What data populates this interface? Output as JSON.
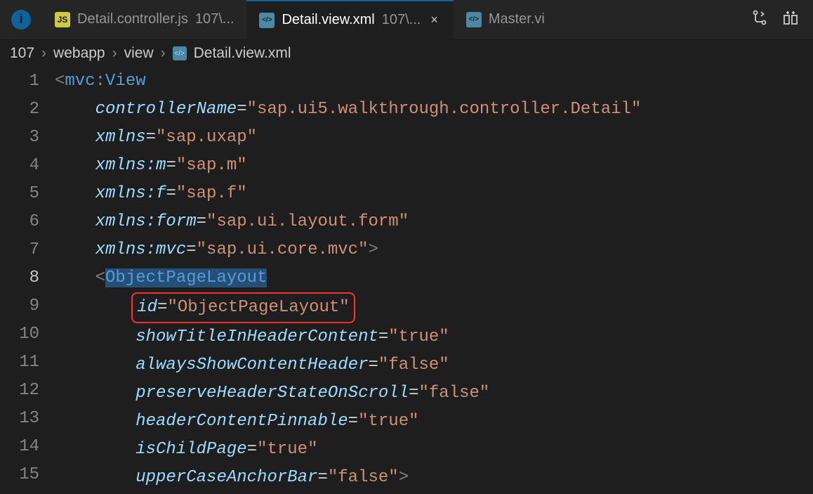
{
  "tabs": [
    {
      "icon_type": "js",
      "icon_text": "JS",
      "label": "Detail.controller.js",
      "suffix": "107\\...",
      "active": false,
      "closable": false
    },
    {
      "icon_type": "xml",
      "icon_text": "",
      "label": "Detail.view.xml",
      "suffix": "107\\...",
      "active": true,
      "closable": true
    },
    {
      "icon_type": "xml",
      "icon_text": "",
      "label": "Master.vi",
      "suffix": "",
      "active": false,
      "closable": false
    }
  ],
  "breadcrumb": {
    "parts": [
      "107",
      "webapp",
      "view"
    ],
    "file": "Detail.view.xml"
  },
  "code": {
    "lines": [
      {
        "n": 1,
        "indent": 0,
        "tokens": [
          [
            "punct",
            "<"
          ],
          [
            "tag-name",
            "mvc:View"
          ]
        ]
      },
      {
        "n": 2,
        "indent": 1,
        "tokens": [
          [
            "attr-name",
            "controllerName"
          ],
          [
            "op",
            "="
          ],
          [
            "attr-val",
            "\"sap.ui5.walkthrough.controller.Detail\""
          ]
        ]
      },
      {
        "n": 3,
        "indent": 1,
        "tokens": [
          [
            "attr-name",
            "xmlns"
          ],
          [
            "op",
            "="
          ],
          [
            "attr-val",
            "\"sap.uxap\""
          ]
        ]
      },
      {
        "n": 4,
        "indent": 1,
        "tokens": [
          [
            "attr-name",
            "xmlns:m"
          ],
          [
            "op",
            "="
          ],
          [
            "attr-val",
            "\"sap.m\""
          ]
        ]
      },
      {
        "n": 5,
        "indent": 1,
        "tokens": [
          [
            "attr-name",
            "xmlns:f"
          ],
          [
            "op",
            "="
          ],
          [
            "attr-val",
            "\"sap.f\""
          ]
        ]
      },
      {
        "n": 6,
        "indent": 1,
        "tokens": [
          [
            "attr-name",
            "xmlns:form"
          ],
          [
            "op",
            "="
          ],
          [
            "attr-val",
            "\"sap.ui.layout.form\""
          ]
        ]
      },
      {
        "n": 7,
        "indent": 1,
        "tokens": [
          [
            "attr-name",
            "xmlns:mvc"
          ],
          [
            "op",
            "="
          ],
          [
            "attr-val",
            "\"sap.ui.core.mvc\""
          ],
          [
            "punct",
            ">"
          ]
        ]
      },
      {
        "n": 8,
        "indent": 1,
        "current": true,
        "tokens": [
          [
            "punct",
            "<"
          ],
          [
            "tag-name selection",
            "ObjectPageLayout"
          ]
        ]
      },
      {
        "n": 9,
        "indent": 2,
        "highlight": true,
        "tokens": [
          [
            "attr-name",
            "id"
          ],
          [
            "op",
            "="
          ],
          [
            "attr-val",
            "\"ObjectPageLayout\""
          ]
        ]
      },
      {
        "n": 10,
        "indent": 2,
        "tokens": [
          [
            "attr-name",
            "showTitleInHeaderContent"
          ],
          [
            "op",
            "="
          ],
          [
            "attr-val",
            "\"true\""
          ]
        ]
      },
      {
        "n": 11,
        "indent": 2,
        "tokens": [
          [
            "attr-name",
            "alwaysShowContentHeader"
          ],
          [
            "op",
            "="
          ],
          [
            "attr-val",
            "\"false\""
          ]
        ]
      },
      {
        "n": 12,
        "indent": 2,
        "tokens": [
          [
            "attr-name",
            "preserveHeaderStateOnScroll"
          ],
          [
            "op",
            "="
          ],
          [
            "attr-val",
            "\"false\""
          ]
        ]
      },
      {
        "n": 13,
        "indent": 2,
        "tokens": [
          [
            "attr-name",
            "headerContentPinnable"
          ],
          [
            "op",
            "="
          ],
          [
            "attr-val",
            "\"true\""
          ]
        ]
      },
      {
        "n": 14,
        "indent": 2,
        "tokens": [
          [
            "attr-name",
            "isChildPage"
          ],
          [
            "op",
            "="
          ],
          [
            "attr-val",
            "\"true\""
          ]
        ]
      },
      {
        "n": 15,
        "indent": 2,
        "tokens": [
          [
            "attr-name",
            "upperCaseAnchorBar"
          ],
          [
            "op",
            "="
          ],
          [
            "attr-val",
            "\"false\""
          ],
          [
            "punct",
            ">"
          ]
        ]
      }
    ]
  }
}
